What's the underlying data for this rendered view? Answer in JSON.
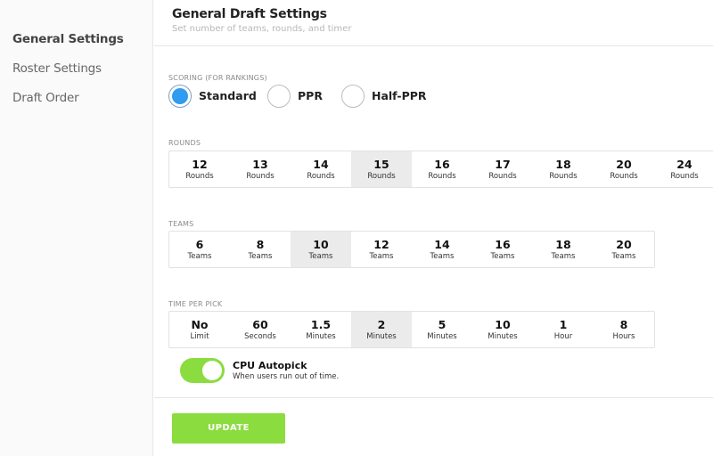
{
  "sidebar": {
    "items": [
      {
        "label": "General Settings",
        "active": true
      },
      {
        "label": "Roster Settings",
        "active": false
      },
      {
        "label": "Draft Order",
        "active": false
      }
    ]
  },
  "header": {
    "title": "General Draft Settings",
    "subtitle": "Set number of teams, rounds, and timer"
  },
  "scoring": {
    "label": "SCORING (FOR RANKINGS)",
    "options": [
      {
        "label": "Standard",
        "selected": true
      },
      {
        "label": "PPR",
        "selected": false
      },
      {
        "label": "Half-PPR",
        "selected": false
      }
    ]
  },
  "rounds": {
    "label": "ROUNDS",
    "options": [
      {
        "value": "12",
        "unit": "Rounds",
        "selected": false
      },
      {
        "value": "13",
        "unit": "Rounds",
        "selected": false
      },
      {
        "value": "14",
        "unit": "Rounds",
        "selected": false
      },
      {
        "value": "15",
        "unit": "Rounds",
        "selected": true
      },
      {
        "value": "16",
        "unit": "Rounds",
        "selected": false
      },
      {
        "value": "17",
        "unit": "Rounds",
        "selected": false
      },
      {
        "value": "18",
        "unit": "Rounds",
        "selected": false
      },
      {
        "value": "20",
        "unit": "Rounds",
        "selected": false
      },
      {
        "value": "24",
        "unit": "Rounds",
        "selected": false
      }
    ]
  },
  "teams": {
    "label": "TEAMS",
    "options": [
      {
        "value": "6",
        "unit": "Teams",
        "selected": false
      },
      {
        "value": "8",
        "unit": "Teams",
        "selected": false
      },
      {
        "value": "10",
        "unit": "Teams",
        "selected": true
      },
      {
        "value": "12",
        "unit": "Teams",
        "selected": false
      },
      {
        "value": "14",
        "unit": "Teams",
        "selected": false
      },
      {
        "value": "16",
        "unit": "Teams",
        "selected": false
      },
      {
        "value": "18",
        "unit": "Teams",
        "selected": false
      },
      {
        "value": "20",
        "unit": "Teams",
        "selected": false
      }
    ]
  },
  "time_per_pick": {
    "label": "TIME PER PICK",
    "options": [
      {
        "value": "No",
        "unit": "Limit",
        "selected": false
      },
      {
        "value": "60",
        "unit": "Seconds",
        "selected": false
      },
      {
        "value": "1.5",
        "unit": "Minutes",
        "selected": false
      },
      {
        "value": "2",
        "unit": "Minutes",
        "selected": true
      },
      {
        "value": "5",
        "unit": "Minutes",
        "selected": false
      },
      {
        "value": "10",
        "unit": "Minutes",
        "selected": false
      },
      {
        "value": "1",
        "unit": "Hour",
        "selected": false
      },
      {
        "value": "8",
        "unit": "Hours",
        "selected": false
      }
    ]
  },
  "autopick": {
    "label": "CPU Autopick",
    "description": "When users run out of time.",
    "enabled": true
  },
  "update_button": "UPDATE",
  "colors": {
    "accent_green": "#8bdc3f",
    "radio_blue": "#2f9bf1",
    "selected_bg": "#ebebeb"
  }
}
